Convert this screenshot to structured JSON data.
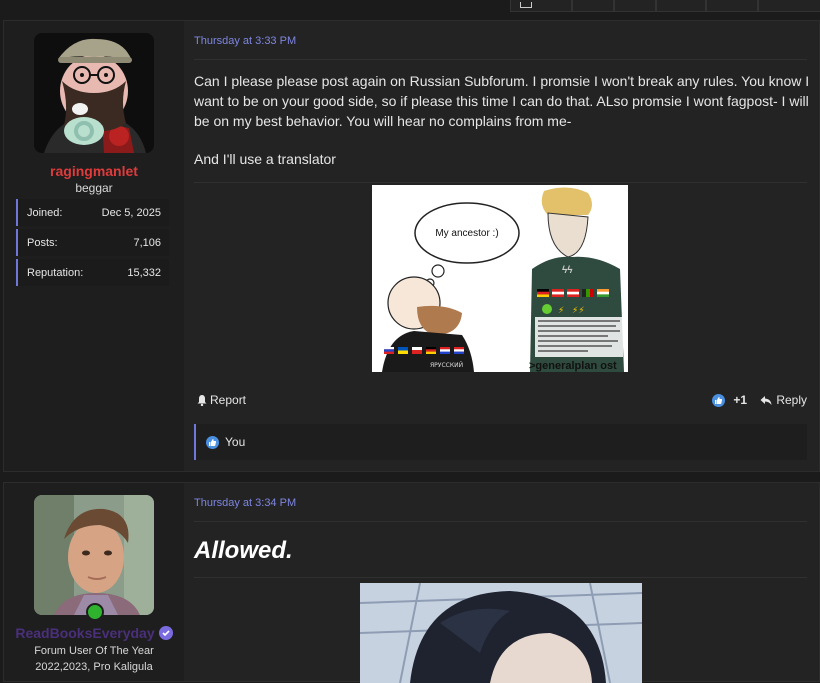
{
  "posts": [
    {
      "author": "ragingmanlet",
      "user_title": "beggar",
      "stats": [
        {
          "label": "Joined:",
          "value": "Dec 5, 2025"
        },
        {
          "label": "Posts:",
          "value": "7,106"
        },
        {
          "label": "Reputation:",
          "value": "15,332"
        }
      ],
      "date": "Thursday at 3:33 PM",
      "body_lines": [
        "Can I please please post again on Russian Subforum. I promsie I won't break any rules. You know I want to be on your good side, so if please this time I can do that. ALso promsie I wont fagpost- I will be on my best behavior. You will hear no complains from me-",
        "And I'll use a translator"
      ],
      "meme": {
        "bubble_text": "My ancestor :)",
        "caption": ">generalplan ost",
        "shirt_text": "ЯРУССКИЙ"
      },
      "actions": {
        "report": "Report",
        "like_count": "+1",
        "reply": "Reply"
      },
      "reactions": {
        "text": "You"
      }
    },
    {
      "author": "ReadBooksEveryday",
      "user_title": "Forum User Of The Year 2022,2023, Pro Kaligula",
      "date": "Thursday at 3:34 PM",
      "body_title": "Allowed."
    }
  ],
  "colors": {
    "username1": "#e03b3b",
    "username2": "#4a2f7a",
    "accent": "#6f77d8",
    "date": "#7e86e0"
  }
}
